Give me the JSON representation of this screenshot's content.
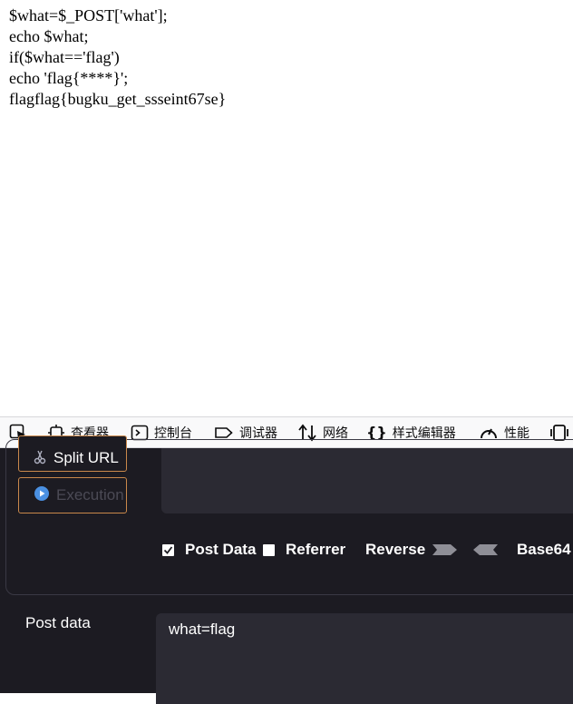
{
  "page": {
    "lines": [
      "$what=$_POST['what'];",
      "echo $what;",
      "if($what=='flag')",
      "echo 'flag{****}';",
      "flagflag{bugku_get_ssseint67se}"
    ]
  },
  "devtools": {
    "tabs": [
      {
        "label": "查看器",
        "icon": "inspector-icon"
      },
      {
        "label": "控制台",
        "icon": "console-icon"
      },
      {
        "label": "调试器",
        "icon": "debugger-icon"
      },
      {
        "label": "网络",
        "icon": "network-icon"
      },
      {
        "label": "样式编辑器",
        "icon": "style-editor-icon"
      },
      {
        "label": "性能",
        "icon": "performance-icon"
      }
    ]
  },
  "hackbar": {
    "split_url_label": "Split URL",
    "execution_label": "Execution",
    "options": {
      "post_data": {
        "label": "Post Data",
        "checked": true
      },
      "referrer": {
        "label": "Referrer",
        "checked": false
      },
      "reverse": "Reverse",
      "base64": "Base64"
    },
    "post_data_label": "Post data",
    "post_data_value": "what=flag"
  },
  "colors": {
    "panel_bg": "#1c1b22",
    "field_bg": "#2b2a33",
    "button_border": "#c9884b",
    "execution_icon": "#4a90e2"
  }
}
